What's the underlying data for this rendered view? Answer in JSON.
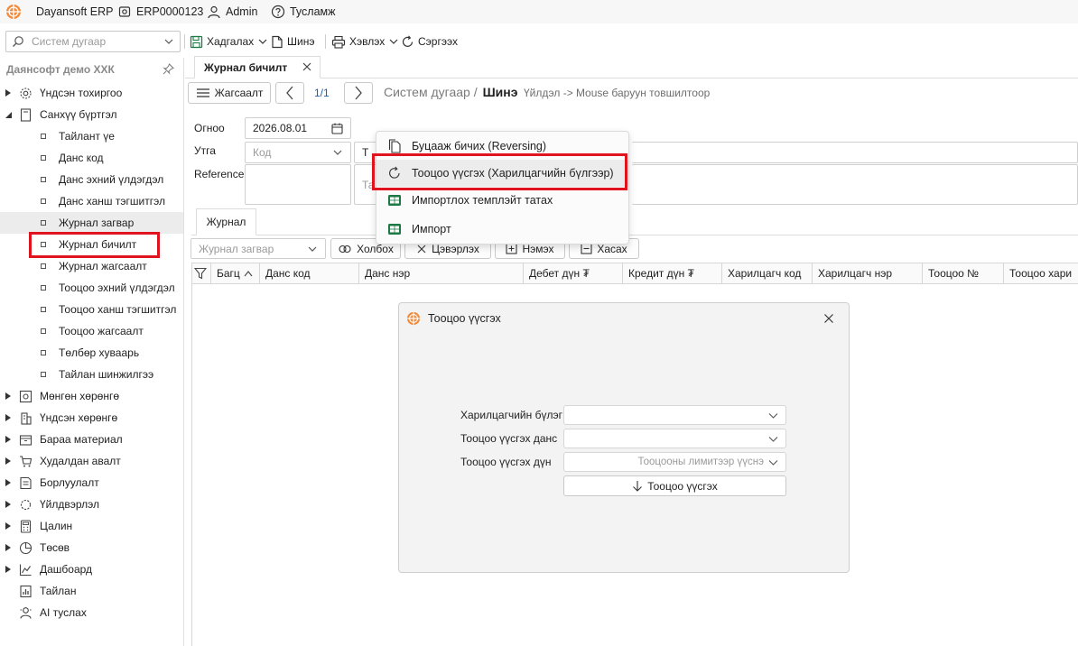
{
  "titlebar": {
    "app": "Dayansoft ERP",
    "company_code": "ERP0000123",
    "user": "Admin",
    "help": "Тусламж"
  },
  "toolbar": {
    "search_placeholder": "Систем дугаар",
    "save": "Хадгалах",
    "new": "Шинэ",
    "print": "Хэвлэх",
    "refresh": "Сэргээх"
  },
  "sidebar": {
    "company": "Даянсофт демо ХХК",
    "items": [
      {
        "label": "Үндсэн тохиргоо",
        "icon": "gear-icon"
      },
      {
        "label": "Санхүү бүртгэл",
        "icon": "book-icon"
      },
      {
        "label": "Тайлант үе"
      },
      {
        "label": "Данс код"
      },
      {
        "label": "Данс эхний үлдэгдэл"
      },
      {
        "label": "Данс ханш тэгшитгэл"
      },
      {
        "label": "Журнал загвар"
      },
      {
        "label": "Журнал бичилт"
      },
      {
        "label": "Журнал жагсаалт"
      },
      {
        "label": "Тооцоо эхний үлдэгдэл"
      },
      {
        "label": "Тооцоо ханш тэгшитгэл"
      },
      {
        "label": "Тооцоо жагсаалт"
      },
      {
        "label": "Төлбөр хуваарь"
      },
      {
        "label": "Тайлан шинжилгээ"
      },
      {
        "label": "Мөнгөн хөрөнгө",
        "icon": "safe-icon"
      },
      {
        "label": "Үндсэн хөрөнгө",
        "icon": "building-icon"
      },
      {
        "label": "Бараа материал",
        "icon": "box-icon"
      },
      {
        "label": "Худалдан авалт",
        "icon": "cart-icon"
      },
      {
        "label": "Борлуулалт",
        "icon": "sales-icon"
      },
      {
        "label": "Үйлдвэрлэл",
        "icon": "factory-icon"
      },
      {
        "label": "Цалин",
        "icon": "calculator-icon"
      },
      {
        "label": "Төсөв",
        "icon": "pie-chart-icon"
      },
      {
        "label": "Дашбоард",
        "icon": "dashboard-icon"
      },
      {
        "label": "Тайлан",
        "icon": "report-icon"
      },
      {
        "label": "AI туслах",
        "icon": "assistant-icon"
      }
    ]
  },
  "main": {
    "tab_label": "Журнал бичилт",
    "list_button": "Жагсаалт",
    "pager": "1/1",
    "breadcrumb_prefix": "Систем дугаар /",
    "breadcrumb_current": "Шинэ",
    "hint": "Үйлдэл -> Mouse баруун товшилтоор",
    "date_label": "Огноо",
    "date_value": "2026.08.01",
    "currency_label": "Утга",
    "code_placeholder": "Код",
    "partial_field_1": "Т",
    "partial_field_2": "Та",
    "reference_label": "Reference",
    "subtab": "Журнал",
    "journal_template_placeholder": "Журнал загвар",
    "link_button": "Холбох",
    "clear_button": "Цэвэрлэх",
    "add_button": "Нэмэх",
    "remove_button": "Хасах",
    "columns": [
      "Багц",
      "Данс код",
      "Данс нэр",
      "Дебет дүн ₮",
      "Кредит дүн ₮",
      "Харилцагч код",
      "Харилцагч нэр",
      "Тооцоо №",
      "Тооцоо хари"
    ]
  },
  "context_menu": {
    "items": [
      "Буцааж бичих (Reversing)",
      "Тооцоо үүсгэх (Харилцагчийн бүлгээр)",
      "Импортлох темплэйт татах",
      "Импорт"
    ]
  },
  "dialog": {
    "title": "Тооцоо үүсгэх",
    "group_label": "Харилцагчийн бүлэг",
    "account_label": "Тооцоо үүсгэх данс",
    "amount_label": "Тооцоо үүсгэх дүн",
    "amount_value": "Тооцооны лимитээр үүснэ",
    "create_button": "Тооцоо үүсгэх"
  },
  "colors": {
    "highlight": "#e0141e",
    "excel_green": "#1d7a45"
  }
}
